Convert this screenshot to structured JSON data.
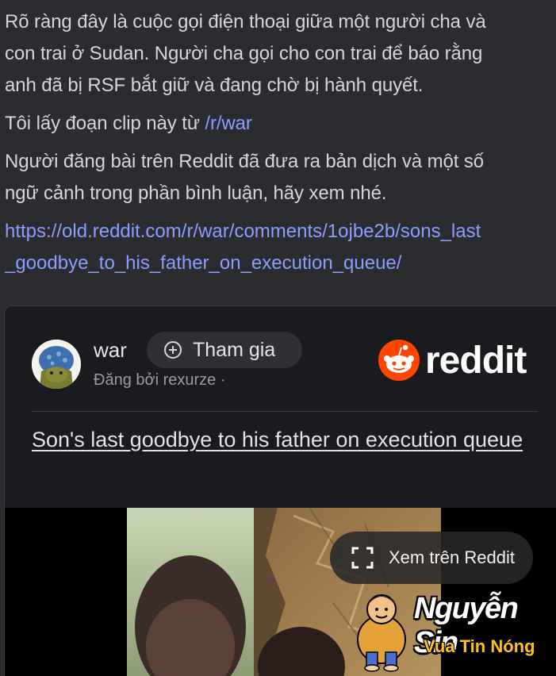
{
  "post": {
    "para1_line1": "Rõ ràng đây là cuộc gọi điện thoại giữa một người cha và",
    "para1_line2": "con trai ở Sudan. Người cha gọi cho con trai để báo rằng",
    "para1_line3": "anh đã bị RSF bắt giữ và đang chờ bị hành quyết.",
    "para2_text": "Tôi lấy đoạn clip này từ ",
    "para2_link": "/r/war",
    "para3_line1": "Người đăng bài trên Reddit đã đưa ra bản dịch và một số",
    "para3_line2": "ngữ cảnh trong phần bình luận, hãy xem nhé.",
    "url_line1": "https://old.reddit.com/r/war/comments/1ojbe2b/sons_last",
    "url_line2": "_goodbye_to_his_father_on_execution_queue/"
  },
  "embed": {
    "subreddit": "war",
    "join_label": "Tham gia",
    "posted_by": "Đăng bởi rexurze ·",
    "logo_text": "reddit",
    "title": "Son's last goodbye to his father on execution queue",
    "view_on_label": "Xem trên Reddit"
  },
  "watermark": {
    "name": "Nguyễn Sin",
    "tagline": "Vua Tin Nóng"
  },
  "colors": {
    "background": "#2b2c30",
    "link": "#8c9cff",
    "reddit_orange": "#ff4500",
    "watermark_yellow": "#ffc21a"
  },
  "icons": [
    "plus-circle-icon",
    "reddit-snoo-icon",
    "expand-icon"
  ]
}
